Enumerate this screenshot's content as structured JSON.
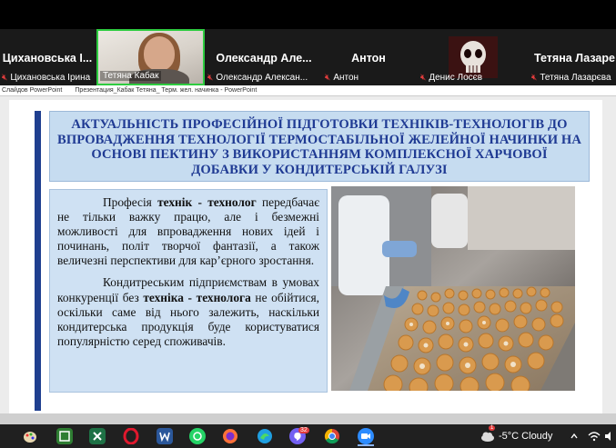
{
  "participants": [
    {
      "name": "Цихановська І...",
      "label": "Цихановська Ірина",
      "muted": true
    },
    {
      "name": "",
      "label": "Тетяна Кабак",
      "muted": false,
      "active": true
    },
    {
      "name": "Олександр Але...",
      "label": "Олександр Алексан...",
      "muted": true
    },
    {
      "name": "Антон",
      "label": "Антон",
      "muted": true
    },
    {
      "name": "",
      "label": "Денис Лосєв",
      "muted": true
    },
    {
      "name": "Тетяна Лазаре",
      "label": "Тетяна Лазарєва",
      "muted": true
    }
  ],
  "ppt_bar": {
    "app": "Слайдов PowerPoint",
    "doc": "Презентация_Кабак Тетяна_ Терм. жел. начинка - PowerPoint"
  },
  "slide": {
    "title": "АКТУАЛЬНІСТЬ ПРОФЕСІЙНОЇ ПІДГОТОВКИ ТЕХНІКІВ-ТЕХНОЛОГІВ ДО ВПРОВАДЖЕННЯ ТЕХНОЛОГІЇ ТЕРМОСТАБІЛЬНОЇ ЖЕЛЕЙНОЇ НАЧИНКИ НА ОСНОВІ ПЕКТИНУ З ВИКОРИСТАННЯМ КОМПЛЕКСНОЇ ХАРЧОВОЇ ДОБАВКИ У КОНДИТЕРСЬКІЙ ГАЛУЗІ",
    "p1_a": "Професія ",
    "p1_b": "технік - технолог",
    "p1_c": " передбачає не тільки важку працю, але і безмежні можливості для впровадження нових ідей і починань, політ творчої фантазії, а також величезні перспективи для кар’єрного зростання.",
    "p2_a": "Кондитреським підприємствам в умовах конкуренції без ",
    "p2_b": "техніка - технолога",
    "p2_c": " не обійтися, оскільки саме від нього залежить, наскільки кондитерська продукція буде користуватися популярністю серед споживачів."
  },
  "taskbar": {
    "weather": "-5°C  Cloudy",
    "notification_count": "1",
    "badge_viber": "32"
  },
  "colors": {
    "title_text": "#1f3a93",
    "title_bg": "#c6dcf0",
    "slide_bar": "#1f3f8f",
    "active_border": "#2ecc40"
  }
}
